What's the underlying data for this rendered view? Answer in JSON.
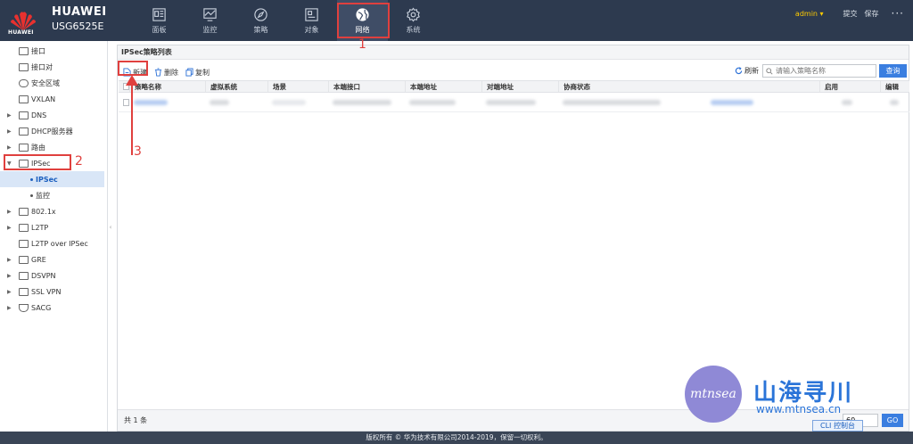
{
  "header": {
    "brand": "HUAWEI",
    "logo_text": "HUAWEI",
    "model": "USG6525E",
    "nav": [
      {
        "label": "面板",
        "icon": "dashboard-icon"
      },
      {
        "label": "监控",
        "icon": "monitor-icon"
      },
      {
        "label": "策略",
        "icon": "compass-icon"
      },
      {
        "label": "对象",
        "icon": "object-icon"
      },
      {
        "label": "网络",
        "icon": "network-globe-icon",
        "active": true
      },
      {
        "label": "系统",
        "icon": "gear-icon"
      }
    ],
    "user": "admin ▾",
    "submit": "提交",
    "save": "保存",
    "more": "···"
  },
  "sidebar": {
    "items": [
      {
        "label": "接口"
      },
      {
        "label": "接口对"
      },
      {
        "label": "安全区域"
      },
      {
        "label": "VXLAN"
      },
      {
        "label": "DNS"
      },
      {
        "label": "DHCP服务器"
      },
      {
        "label": "路由"
      },
      {
        "label": "IPSec"
      },
      {
        "label": "IPSec"
      },
      {
        "label": "监控"
      },
      {
        "label": "802.1x"
      },
      {
        "label": "L2TP"
      },
      {
        "label": "L2TP over IPSec"
      },
      {
        "label": "GRE"
      },
      {
        "label": "DSVPN"
      },
      {
        "label": "SSL VPN"
      },
      {
        "label": "SACG"
      }
    ]
  },
  "main": {
    "title": "IPSec策略列表",
    "toolbar": {
      "new": "新建",
      "delete": "删除",
      "copy": "复制",
      "refresh": "刷新",
      "search_placeholder": "请输入策略名称",
      "query": "查询"
    },
    "columns": [
      "策略名称",
      "虚拟系统",
      "场景",
      "本端接口",
      "本端地址",
      "对端地址",
      "协商状态",
      "启用",
      "编辑"
    ],
    "footer": {
      "total": "共 1 条",
      "page_size": "60",
      "go": "GO"
    }
  },
  "cli_tab": "CLI 控制台",
  "copyright": "版权所有 © 华为技术有限公司2014-2019，保留一切权利。",
  "annotations": {
    "one": "1",
    "two": "2",
    "three": "3"
  },
  "watermark": {
    "logo_text": "mtnsea",
    "title": "山海寻川",
    "url": "www.mtnsea.cn"
  },
  "colors": {
    "accent": "#3a7ee0",
    "topbar": "#2d3a4f",
    "annotation": "#e0403e"
  }
}
